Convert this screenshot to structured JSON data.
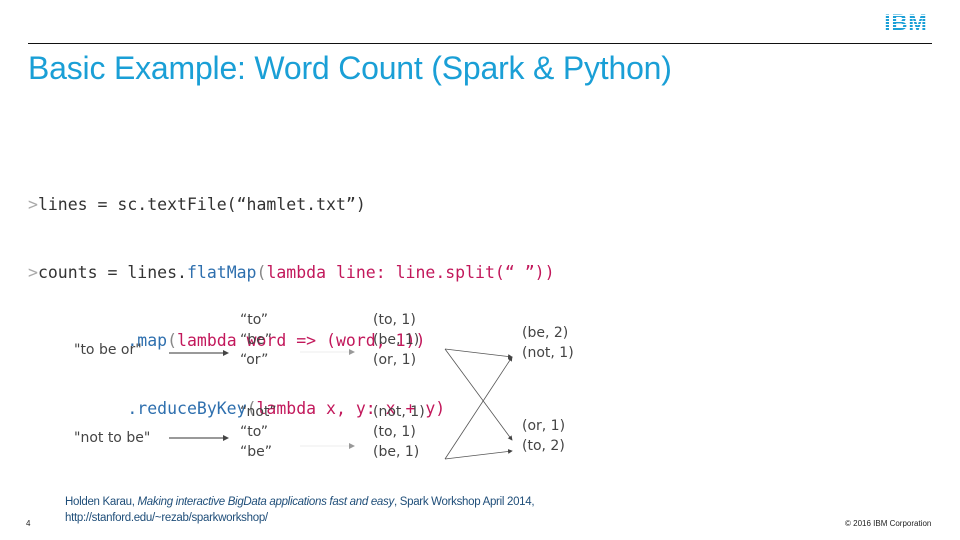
{
  "header": {
    "logo_text": "IBM",
    "logo_color": "#1a9fd6",
    "title": "Basic Example: Word Count (Spark & Python)",
    "title_color": "#1a9fd6"
  },
  "code": {
    "line1": {
      "prompt": ">",
      "text_a": "lines = sc.textFile(",
      "string": "“hamlet.txt”",
      "text_b": ")"
    },
    "line2": {
      "prompt": ">",
      "text_a": "counts = lines.",
      "fn": "flatMap",
      "paren": "(",
      "lambda": "lambda line: line.split(“ ”))"
    },
    "line3": {
      "indent": "          ",
      "fn": ".map",
      "paren": "(",
      "lambda": "lambda word => (word, 1))"
    },
    "line4": {
      "indent": "          ",
      "fn": ".reduceByKey",
      "paren": "(",
      "lambda": "lambda x, y: x + y)"
    },
    "colors": {
      "prompt": "#aaaaaa",
      "function": "#2e6fae",
      "lambda": "#c2185b",
      "text": "#333333"
    }
  },
  "diagram": {
    "inputs": [
      "\"to be or\"",
      "\"not to be\""
    ],
    "split_words": [
      [
        "“to”",
        "“be”",
        "“or”"
      ],
      [
        "“not”",
        "“to”",
        "“be”"
      ]
    ],
    "pairs": [
      [
        "(to, 1)",
        "(be, 1)",
        "(or, 1)"
      ],
      [
        "(not, 1)",
        "(to, 1)",
        "(be, 1)"
      ]
    ],
    "reduced": [
      [
        "(be, 2)",
        "(not, 1)"
      ],
      [
        "(or, 1)",
        "(to, 2)"
      ]
    ]
  },
  "footer": {
    "page_number": "4",
    "citation_author": "Holden Karau, ",
    "citation_title": "Making interactive BigData applications fast and easy",
    "citation_rest": ", Spark Workshop April 2014,",
    "citation_url": "http://stanford.edu/~rezab/sparkworkshop/",
    "copyright": "© 2016 IBM Corporation"
  }
}
